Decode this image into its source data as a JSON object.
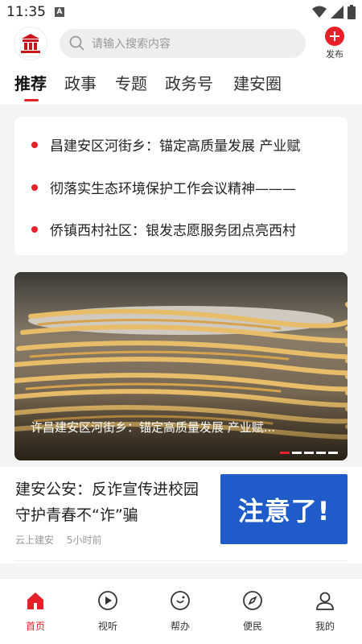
{
  "status_bar": {
    "time": "11:35",
    "notification_letter": "A"
  },
  "header": {
    "search_placeholder": "请输入搜索内容",
    "publish_label": "发布"
  },
  "tabs": [
    {
      "label": "推荐",
      "active": true
    },
    {
      "label": "政事",
      "active": false
    },
    {
      "label": "专题",
      "active": false
    },
    {
      "label": "政务号",
      "active": false
    },
    {
      "label": "建安圈",
      "active": false
    }
  ],
  "headlines": [
    "昌建安区河街乡：锚定高质量发展 产业赋",
    "彻落实生态环境保护工作会议精神———",
    "侨镇西村社区：银发志愿服务团点亮西村"
  ],
  "banner": {
    "caption": "许昌建安区河街乡：锚定高质量发展 产业赋...",
    "slide_count": 5,
    "active_slide": 1
  },
  "article": {
    "title": "建安公安：反诈宣传进校园 守护青春不“诈”骗",
    "source": "云上建安",
    "time": "5小时前",
    "thumb_text": "注意了!"
  },
  "bottom_nav": [
    {
      "label": "首页",
      "icon": "home-icon",
      "active": true
    },
    {
      "label": "视听",
      "icon": "play-icon",
      "active": false
    },
    {
      "label": "帮办",
      "icon": "help-icon",
      "active": false
    },
    {
      "label": "便民",
      "icon": "compass-icon",
      "active": false
    },
    {
      "label": "我的",
      "icon": "profile-icon",
      "active": false
    }
  ],
  "colors": {
    "accent": "#e62129",
    "thumb_blue": "#1f5cc9"
  }
}
